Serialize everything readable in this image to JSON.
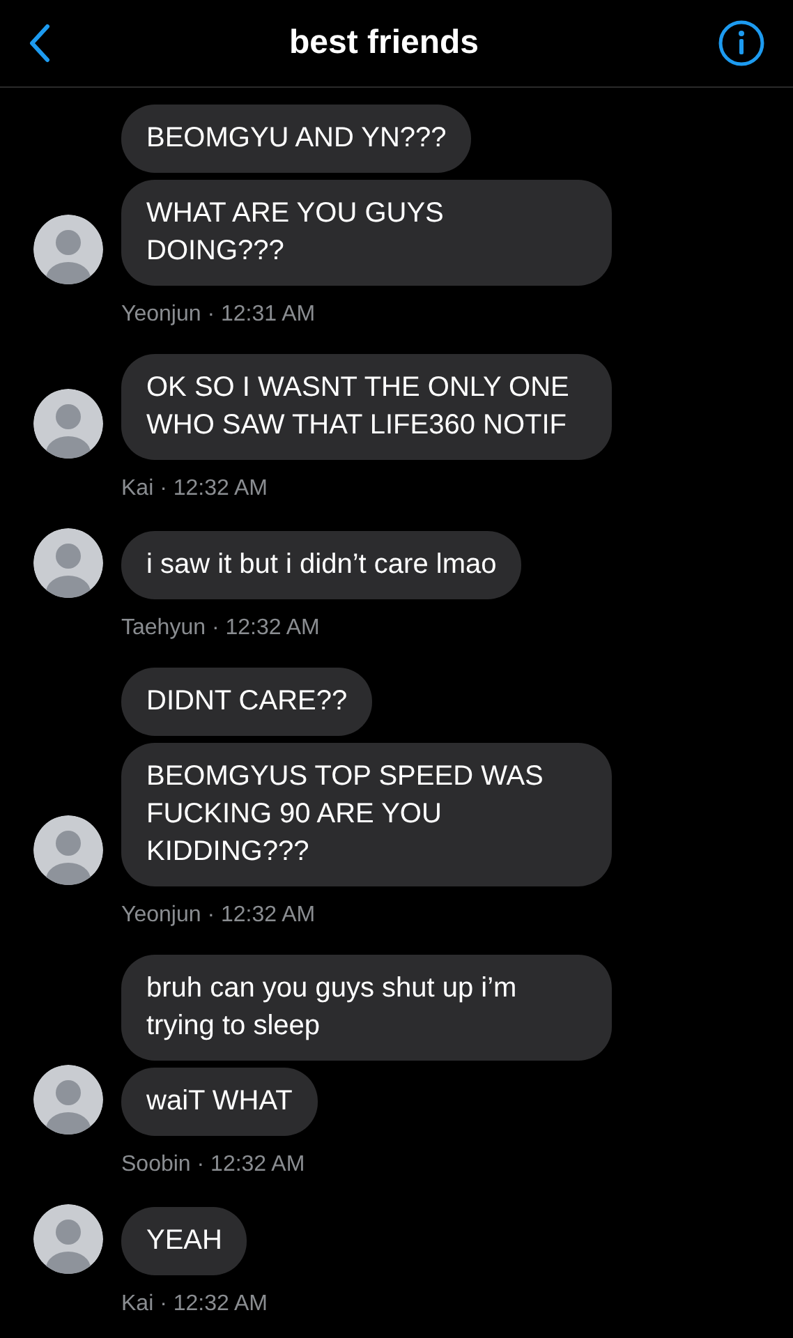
{
  "header": {
    "title": "best friends"
  },
  "groups": [
    {
      "caption": "Yeonjun · 12:31 AM",
      "messages": [
        "BEOMGYU AND YN???",
        "WHAT ARE YOU GUYS DOING???"
      ]
    },
    {
      "caption": "Kai · 12:32 AM",
      "messages": [
        "OK SO I WASNT THE ONLY ONE WHO SAW THAT LIFE360 NOTIF"
      ]
    },
    {
      "caption": "Taehyun · 12:32 AM",
      "messages": [
        "i saw it but i didn’t care lmao"
      ]
    },
    {
      "caption": "Yeonjun · 12:32 AM",
      "messages": [
        "DIDNT CARE??",
        "BEOMGYUS TOP SPEED WAS FUCKING 90 ARE YOU KIDDING???"
      ]
    },
    {
      "caption": "Soobin · 12:32 AM",
      "messages": [
        "bruh can you guys shut up i’m trying to sleep",
        "waiT WHAT"
      ]
    },
    {
      "caption": "Kai · 12:32 AM",
      "messages": [
        "YEAH"
      ]
    }
  ]
}
